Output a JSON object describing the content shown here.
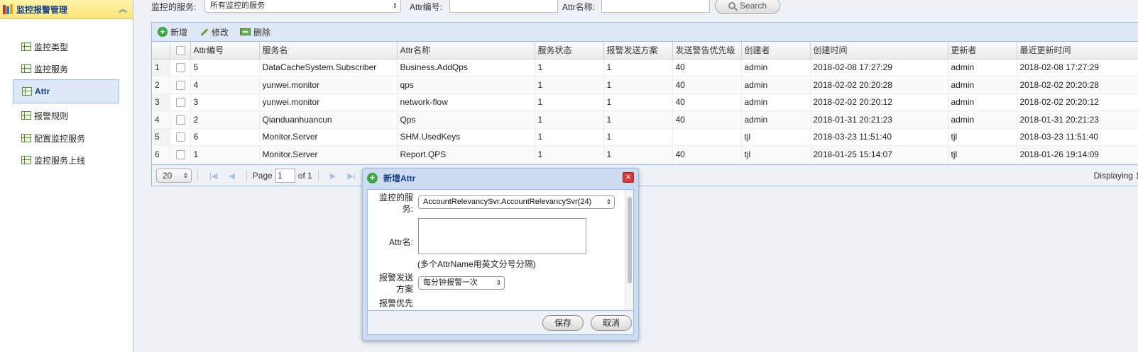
{
  "sidebar": {
    "title": "监控报警管理",
    "items": [
      {
        "label": "监控类型"
      },
      {
        "label": "监控服务"
      },
      {
        "label": "Attr"
      },
      {
        "label": "报警规则"
      },
      {
        "label": "配置监控服务"
      },
      {
        "label": "监控服务上线"
      }
    ],
    "active_index": 2
  },
  "filter": {
    "service_label": "监控的服务:",
    "service_value": "所有监控的服务",
    "attr_id_label": "Attr编号:",
    "attr_id_value": "",
    "attr_name_label": "Attr名称:",
    "attr_name_value": "",
    "search_label": "Search"
  },
  "toolbar": {
    "add_label": "新增",
    "edit_label": "修改",
    "delete_label": "删除"
  },
  "table": {
    "columns": [
      "Attr编号",
      "服务名",
      "Attr名称",
      "服务状态",
      "报警发送方案",
      "发送警告优先级",
      "创建者",
      "创建时间",
      "更新者",
      "最近更新时间"
    ],
    "rows": [
      {
        "n": "1",
        "id": "5",
        "service": "DataCacheSystem.Subscriber",
        "attr": "Business.AddQps",
        "status": "1",
        "plan": "1",
        "priority": "40",
        "creator": "admin",
        "created": "2018-02-08 17:27:29",
        "updater": "admin",
        "updated": "2018-02-08 17:27:29"
      },
      {
        "n": "2",
        "id": "4",
        "service": "yunwei.monitor",
        "attr": "qps",
        "status": "1",
        "plan": "1",
        "priority": "40",
        "creator": "admin",
        "created": "2018-02-02 20:20:28",
        "updater": "admin",
        "updated": "2018-02-02 20:20:28"
      },
      {
        "n": "3",
        "id": "3",
        "service": "yunwei.monitor",
        "attr": "network-flow",
        "status": "1",
        "plan": "1",
        "priority": "40",
        "creator": "admin",
        "created": "2018-02-02 20:20:12",
        "updater": "admin",
        "updated": "2018-02-02 20:20:12"
      },
      {
        "n": "4",
        "id": "2",
        "service": "Qianduanhuancun",
        "attr": "Qps",
        "status": "1",
        "plan": "1",
        "priority": "40",
        "creator": "admin",
        "created": "2018-01-31 20:21:23",
        "updater": "admin",
        "updated": "2018-01-31 20:21:23"
      },
      {
        "n": "5",
        "id": "6",
        "service": "Monitor.Server",
        "attr": "SHM.UsedKeys",
        "status": "1",
        "plan": "1",
        "priority": "",
        "creator": "tjl",
        "created": "2018-03-23 11:51:40",
        "updater": "tjl",
        "updated": "2018-03-23 11:51:40"
      },
      {
        "n": "6",
        "id": "1",
        "service": "Monitor.Server",
        "attr": "Report.QPS",
        "status": "1",
        "plan": "1",
        "priority": "40",
        "creator": "tjl",
        "created": "2018-01-25 15:14:07",
        "updater": "tjl",
        "updated": "2018-01-26 19:14:09"
      }
    ]
  },
  "pager": {
    "page_size": "20",
    "page_label": "Page",
    "page_value": "1",
    "of_label": "of 1",
    "displaying": "Displaying 1"
  },
  "dialog": {
    "title": "新增Attr",
    "service_label": "监控的服务:",
    "service_value": "AccountRelevancySvr.AccountRelevancySvr(24)",
    "attr_label": "Attr名:",
    "hint": "(多个AttrName用英文分号分隔)",
    "plan_label": "报警发送方案",
    "plan_value": "每分钟报警一次",
    "priority_label": "报警优先级",
    "save_label": "保存",
    "cancel_label": "取消"
  }
}
